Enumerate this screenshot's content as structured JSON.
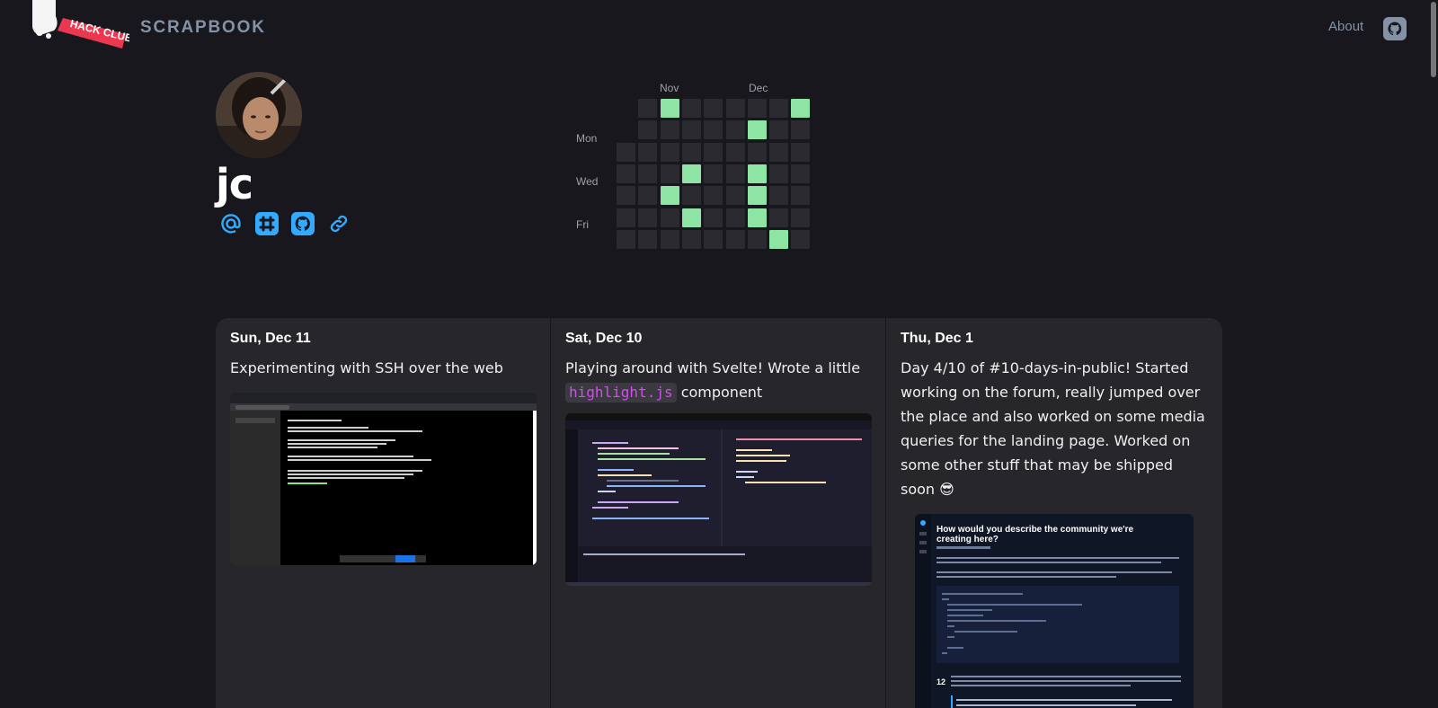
{
  "header": {
    "logo_text": "HACK CLUB",
    "brand": "SCRAPBOOK",
    "about_label": "About"
  },
  "profile": {
    "username": "jc",
    "links": [
      "email-icon",
      "slack-icon",
      "github-icon",
      "website-link-icon"
    ]
  },
  "heatmap": {
    "months": [
      "Nov",
      "Dec"
    ],
    "day_labels": [
      "Mon",
      "Wed",
      "Fri"
    ],
    "active_color": "#8ee4a4",
    "empty_color": "#2a2a30"
  },
  "posts": [
    {
      "date": "Sun, Dec 11",
      "text": "Experimenting with SSH over the web"
    },
    {
      "date": "Sat, Dec 10",
      "text_before": "Playing around with Svelte! Wrote a little",
      "code": "highlight.js",
      "text_after": "component"
    },
    {
      "date": "Thu, Dec 1",
      "text": "Day 4/10 of #10-days-in-public! Started working on the forum, really jumped over the place and also worked on some media queries for the landing page. Worked on some other stuff that may be shipped soon",
      "emoji": "😎",
      "image_title": "How would you describe the community we're creating here?",
      "image_count": "12"
    }
  ]
}
